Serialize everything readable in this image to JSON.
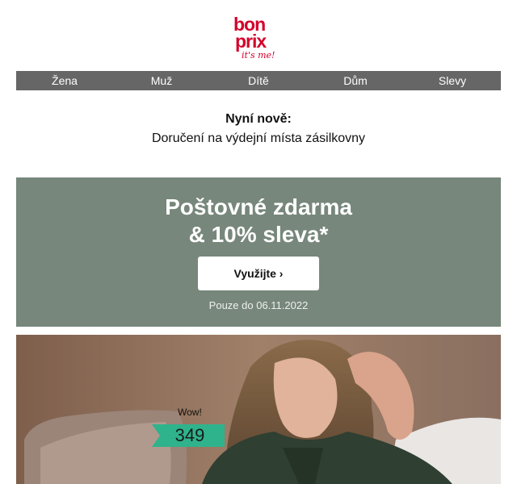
{
  "brand": {
    "line1": "bon",
    "line2": "prix",
    "tagline": "it's me!"
  },
  "nav": {
    "items": [
      "Žena",
      "Muž",
      "Dítě",
      "Dům",
      "Slevy"
    ]
  },
  "news": {
    "title": "Nyní nově:",
    "subtitle": "Doručení na výdejní místa zásilkovny"
  },
  "promo": {
    "headline1": "Poštovné zdarma",
    "headline2": "& 10% sleva*",
    "cta": "Využijte ›",
    "valid_until": "Pouze do 06.11.2022",
    "bg_color": "#77877b"
  },
  "hero": {
    "badge": "Wow!",
    "price": "349",
    "tag_color": "#2fb38c"
  }
}
